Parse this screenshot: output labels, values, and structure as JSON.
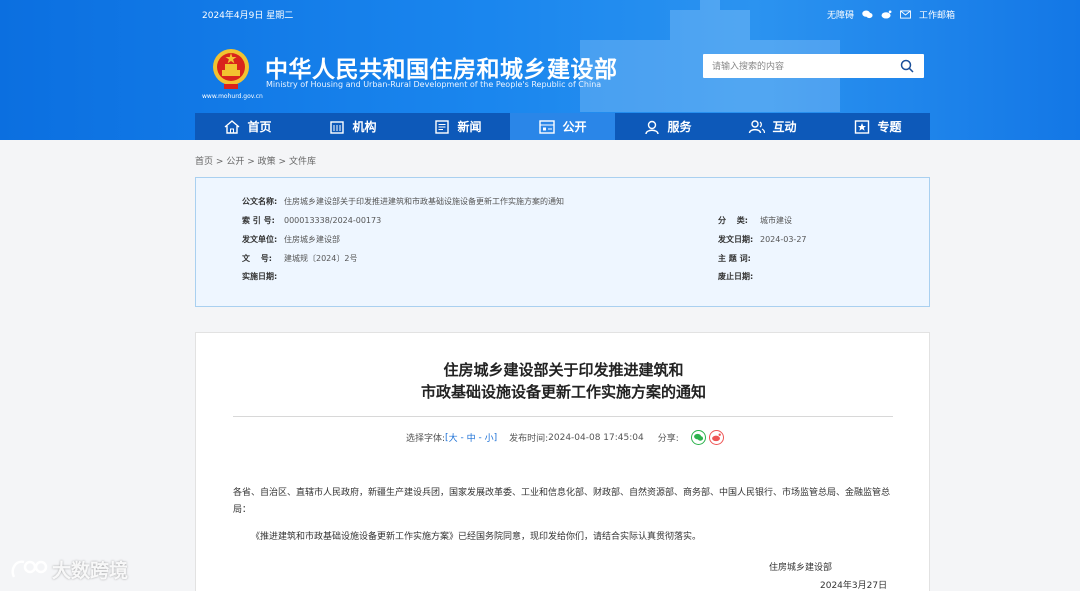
{
  "topbar": {
    "date": "2024年4月9日 星期二",
    "accessibility": "无障碍",
    "email": "工作邮箱"
  },
  "site": {
    "title": "中华人民共和国住房和城乡建设部",
    "subtitle": "Ministry of Housing and Urban-Rural Development of the People's Republic of China",
    "url": "www.mohurd.gov.cn"
  },
  "search": {
    "placeholder": "请输入搜索的内容"
  },
  "nav": [
    {
      "label": "首页",
      "icon": "home-icon"
    },
    {
      "label": "机构",
      "icon": "building-icon"
    },
    {
      "label": "新闻",
      "icon": "news-icon"
    },
    {
      "label": "公开",
      "icon": "open-icon",
      "active": true
    },
    {
      "label": "服务",
      "icon": "service-icon"
    },
    {
      "label": "互动",
      "icon": "interact-icon"
    },
    {
      "label": "专题",
      "icon": "topic-icon"
    }
  ],
  "breadcrumb": {
    "home": "首页",
    "open": "公开",
    "policy": "政策",
    "library": "文件库",
    "sep": ">"
  },
  "meta": {
    "doc_name_label": "公文名称:",
    "doc_name": "住房城乡建设部关于印发推进建筑和市政基础设施设备更新工作实施方案的通知",
    "index_label": "索 引 号:",
    "index": "000013338/2024-00173",
    "category_label": "分　 类:",
    "category": "城市建设",
    "issuer_label": "发文单位:",
    "issuer": "住房城乡建设部",
    "issue_date_label": "发文日期:",
    "issue_date": "2024-03-27",
    "doc_no_label": "文　 号:",
    "doc_no": "建城规〔2024〕2号",
    "keywords_label": "主 题 词:",
    "keywords": "",
    "effective_label": "实施日期:",
    "effective": "",
    "abolish_label": "废止日期:",
    "abolish": ""
  },
  "article": {
    "title_line1": "住房城乡建设部关于印发推进建筑和",
    "title_line2": "市政基础设施设备更新工作实施方案的通知",
    "font_label": "选择字体:",
    "font_large": "大",
    "font_medium": "中",
    "font_small": "小",
    "publish_label": "发布时间:",
    "publish_time": "2024-04-08 17:45:04",
    "share_label": "分享:",
    "recipients": "各省、自治区、直辖市人民政府，新疆生产建设兵团，国家发展改革委、工业和信息化部、财政部、自然资源部、商务部、中国人民银行、市场监管总局、金融监管总局：",
    "body": "《推进建筑和市政基础设施设备更新工作实施方案》已经国务院同意，现印发给你们，请结合实际认真贯彻落实。",
    "signature": "住房城乡建设部",
    "sign_date": "2024年3月27日"
  },
  "watermark": {
    "text": "大数跨境"
  },
  "colors": {
    "header_blue": "#1a86ee",
    "nav_blue": "#0d59b9",
    "nav_active": "#2a86e8",
    "meta_bg": "#eef6ff",
    "link_blue": "#1a6fd6"
  }
}
